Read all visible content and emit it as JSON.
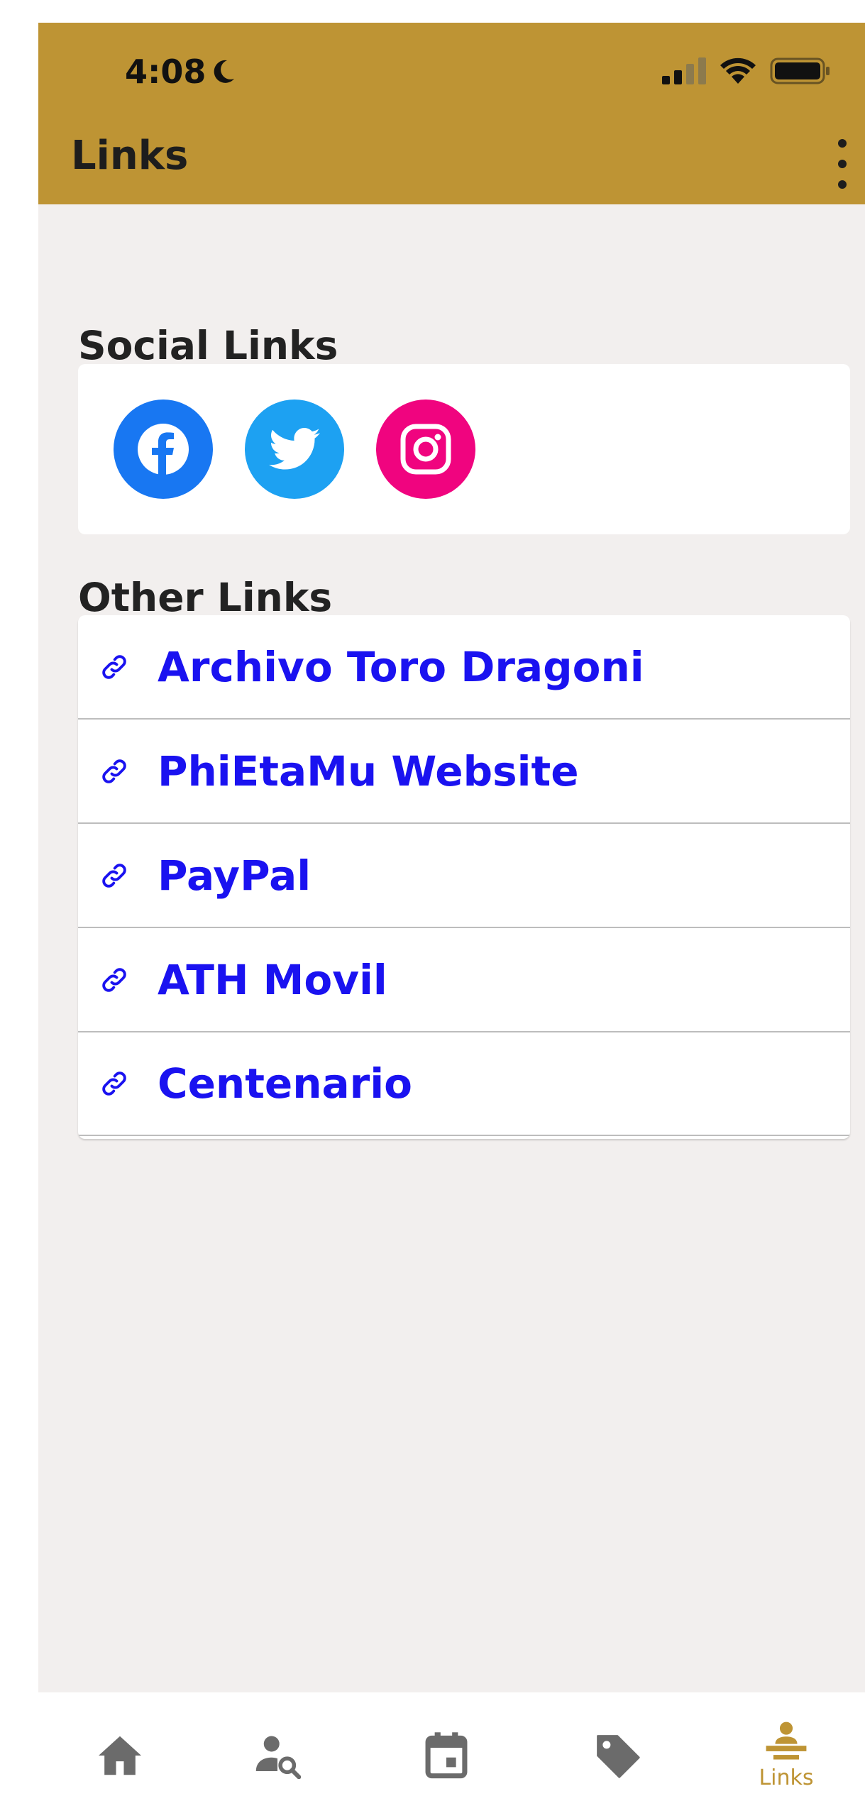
{
  "status_bar": {
    "time": "4:08",
    "moon_icon": "moon-icon",
    "signal_icon": "cellular-signal-icon",
    "wifi_icon": "wifi-icon",
    "battery_icon": "battery-icon"
  },
  "header": {
    "title": "Links",
    "menu_icon": "more-vertical-icon",
    "background_color": "#be9434"
  },
  "social_section": {
    "title": "Social Links",
    "items": [
      {
        "name": "Facebook",
        "icon": "facebook-icon",
        "color": "#1877f2"
      },
      {
        "name": "Twitter",
        "icon": "twitter-icon",
        "color": "#1da1f2"
      },
      {
        "name": "Instagram",
        "icon": "instagram-icon",
        "color": "#f0047f"
      }
    ]
  },
  "other_section": {
    "title": "Other Links",
    "link_color": "#1a12f0",
    "items": [
      {
        "label": "Archivo Toro Dragoni",
        "icon": "link-icon"
      },
      {
        "label": "PhiEtaMu Website",
        "icon": "link-icon"
      },
      {
        "label": "PayPal",
        "icon": "link-icon"
      },
      {
        "label": "ATH Movil",
        "icon": "link-icon"
      },
      {
        "label": "Centenario",
        "icon": "link-icon"
      }
    ]
  },
  "bottom_nav": {
    "active_color": "#be9434",
    "inactive_color": "#6b6b6b",
    "items": [
      {
        "icon": "home-icon",
        "label": "",
        "active": false
      },
      {
        "icon": "person-search-icon",
        "label": "",
        "active": false
      },
      {
        "icon": "calendar-icon",
        "label": "",
        "active": false
      },
      {
        "icon": "tag-icon",
        "label": "",
        "active": false
      },
      {
        "icon": "person-desk-icon",
        "label": "Links",
        "active": true
      }
    ]
  }
}
